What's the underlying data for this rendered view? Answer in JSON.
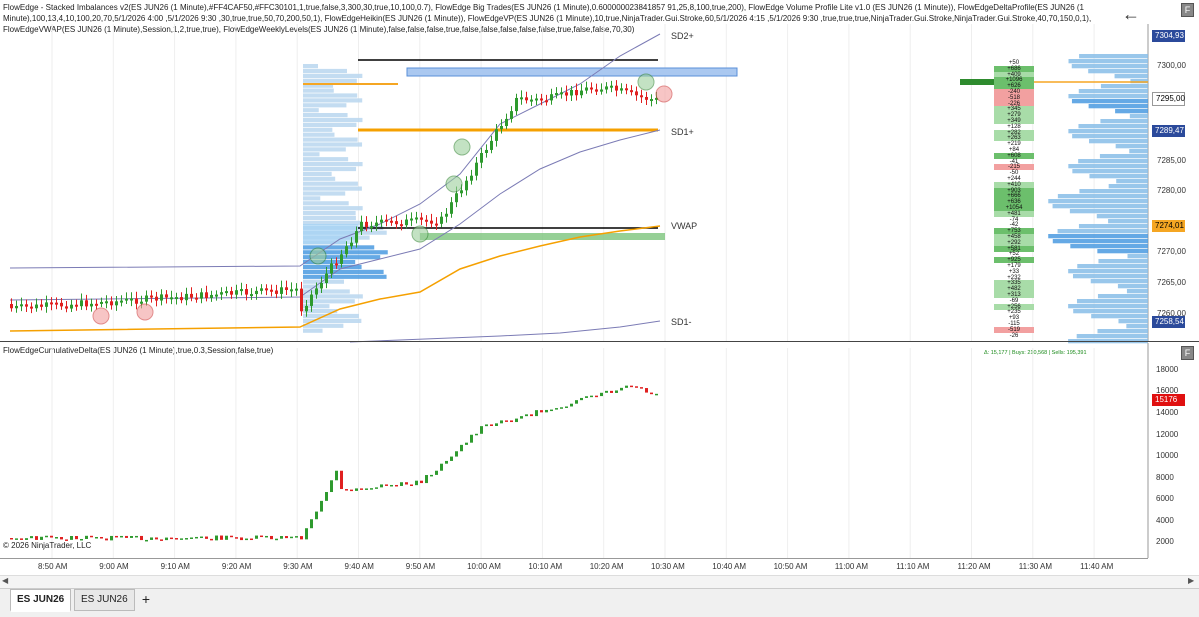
{
  "header": {
    "indicators_text": "FlowEdge - Stacked Imbalances v2(ES JUN26 (1 Minute),#FF4CAF50,#FFC30101,1,true,false,3,300,30,true,10,100,0.7), FlowEdge Big Trades(ES JUN26 (1 Minute),0.600000023841857 91,25,8,100,true,200), FlowEdge Volume Profile Lite v1.0 (ES JUN26 (1 Minute)), FlowEdgeDeltaProfile(ES JUN26 (1 Minute),100,13,4,10,100,20,70,5/1/2026 4:00 ,5/1/2026 9:30 ,30,true,true,50,70,200,50,1), FlowEdgeHeikin(ES JUN26 (1 Minute)), FlowEdgeVP(ES JUN26 (1 Minute),10,true,NinjaTrader.Gui.Stroke,60,5/1/2026 4:15 ,5/1/2026 9:30 ,true,true,true,NinjaTrader.Gui.Stroke,NinjaTrader.Gui.Stroke,40,70,150,0,1), FlowEdgeVWAP(ES JUN26 (1 Minute),Session,1,2,true,true), FlowEdgeWeeklyLevels(ES JUN26 (1 Minute),false,false,false,true,false,false,false,false,false,true,false,false,70,30)"
  },
  "back_icon": "←",
  "f_label": "F",
  "price_axis": {
    "labels": [
      "7300,00",
      "7285,00",
      "7280,00",
      "7270,00",
      "7265,00",
      "7260,00"
    ],
    "tags": [
      {
        "text": "7304,93",
        "color": "#2b4a9b",
        "fg": "#ffffff"
      },
      {
        "text": "7295,00",
        "color": "#ffffff",
        "fg": "#000000"
      },
      {
        "text": "7289,47",
        "color": "#2b4a9b",
        "fg": "#ffffff"
      },
      {
        "text": "7274,01",
        "color": "#f5a623",
        "fg": "#000000"
      },
      {
        "text": "7258,54",
        "color": "#2b4a9b",
        "fg": "#ffffff"
      }
    ]
  },
  "vwap_labels": {
    "sd2plus": "SD2+",
    "sd1plus": "SD1+",
    "vwap": "VWAP",
    "sd1minus": "SD1-"
  },
  "delta_ladder": {
    "rows": [
      "+50",
      "+686",
      "+409",
      "+1096",
      "+626",
      "-240",
      "-518",
      "-226",
      "+345",
      "+279",
      "+349",
      "+128",
      "+282",
      "+263",
      "+219",
      "+84",
      "+608",
      "-41",
      "-215",
      "-50",
      "+244",
      "+410",
      "+903",
      "+666",
      "+636",
      "+1054",
      "+481",
      "-74",
      "-42",
      "+753",
      "+458",
      "+292",
      "+581",
      "+52",
      "+925",
      "+179",
      "+33",
      "+232",
      "+335",
      "+482",
      "+313",
      "-69",
      "+256",
      "+235",
      "+93",
      "-115",
      "-519",
      "-26"
    ]
  },
  "subchart": {
    "title": "FlowEdgeCumulativeDelta(ES JUN26 (1 Minute),true,0.3,Session,false,true)",
    "status": "Δ: 15,177 | Buys: 210,568 | Sells: 195,391",
    "axis_labels": [
      "18000",
      "16000",
      "14000",
      "12000",
      "10000",
      "8000",
      "6000",
      "4000",
      "2000"
    ],
    "current_tag": "15176"
  },
  "copyright": "© 2026 NinjaTrader, LLC",
  "time_axis": [
    "8:50 AM",
    "9:00 AM",
    "9:10 AM",
    "9:20 AM",
    "9:30 AM",
    "9:40 AM",
    "9:50 AM",
    "10:00 AM",
    "10:10 AM",
    "10:20 AM",
    "10:30 AM",
    "10:40 AM",
    "10:50 AM",
    "11:00 AM",
    "11:10 AM",
    "11:20 AM",
    "11:30 AM",
    "11:40 AM"
  ],
  "tabs": [
    {
      "label": "ES JUN26",
      "active": true
    },
    {
      "label": "ES JUN26",
      "active": false
    }
  ],
  "add_tab": "+",
  "colors": {
    "up": "#2e9a2e",
    "down": "#e02020",
    "vwap": "#f5a000",
    "band": "#7b7bb5",
    "profile": "#87bde8",
    "poc": "#f5a623"
  }
}
